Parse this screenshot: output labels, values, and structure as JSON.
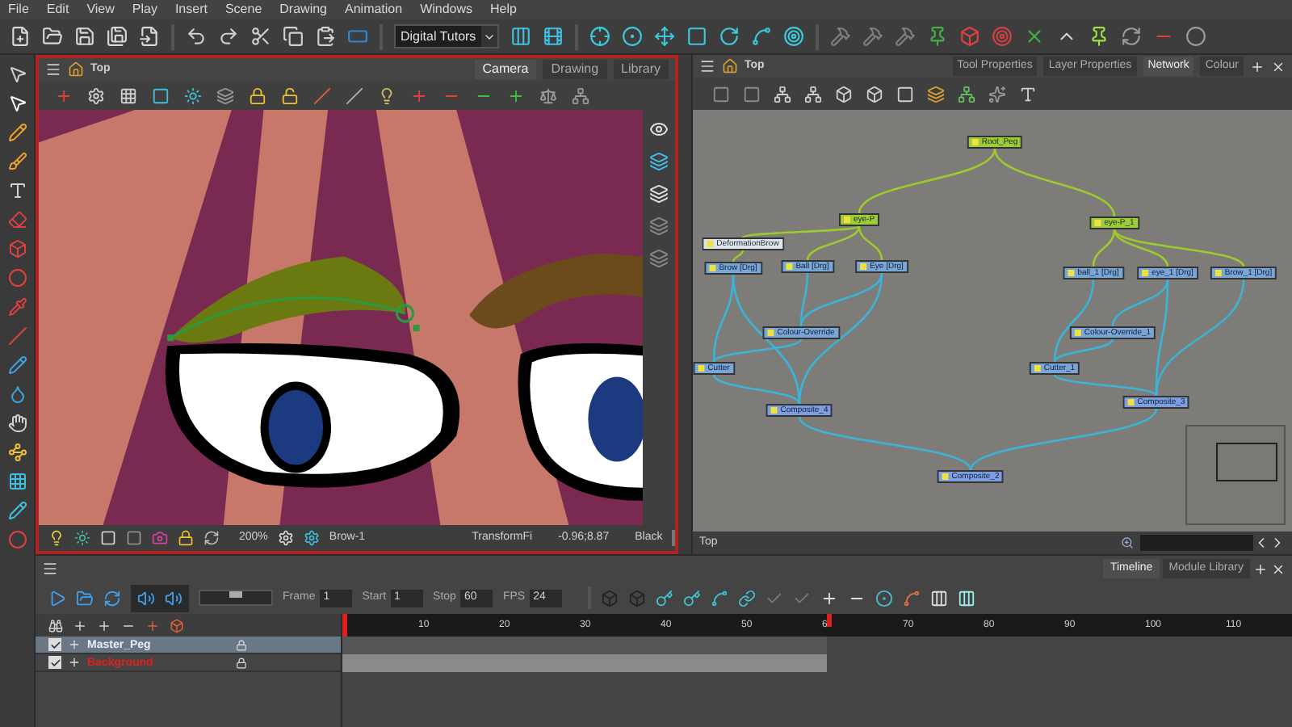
{
  "menu": [
    {
      "label": "File"
    },
    {
      "label": "Edit"
    },
    {
      "label": "View"
    },
    {
      "label": "Play"
    },
    {
      "label": "Insert"
    },
    {
      "label": "Scene"
    },
    {
      "label": "Drawing"
    },
    {
      "label": "Animation"
    },
    {
      "label": "Windows"
    },
    {
      "label": "Help"
    }
  ],
  "toolbar": {
    "workspace": "Digital Tutors"
  },
  "camera_view": {
    "breadcrumb": "Top",
    "tabs": [
      {
        "label": "Camera",
        "selected": true
      },
      {
        "label": "Drawing",
        "selected": false
      },
      {
        "label": "Library",
        "selected": false
      }
    ],
    "status": {
      "zoom": "200%",
      "drawing": "Brow-1",
      "tool": "TransformFi",
      "coords": "-0.96;8.87",
      "colour": "Black"
    }
  },
  "network_view": {
    "breadcrumb": "Top",
    "tabs": [
      {
        "label": "Tool Properties",
        "selected": false
      },
      {
        "label": "Layer Properties",
        "selected": false
      },
      {
        "label": "Network",
        "selected": true
      },
      {
        "label": "Colour",
        "selected": false
      }
    ],
    "nodes": [
      {
        "label": "Root_Peg",
        "kind": "peg"
      },
      {
        "label": "eye-P",
        "kind": "peg"
      },
      {
        "label": "eye-P_1",
        "kind": "peg"
      },
      {
        "label": "DeformationBrow",
        "kind": "deformation"
      },
      {
        "label": "Brow [Drg]",
        "kind": "drawing"
      },
      {
        "label": "Ball [Drg]",
        "kind": "drawing"
      },
      {
        "label": "Eye [Drg]",
        "kind": "drawing"
      },
      {
        "label": "ball_1 [Drg]",
        "kind": "drawing"
      },
      {
        "label": "eye_1 [Drg]",
        "kind": "drawing"
      },
      {
        "label": "Brow_1 [Drg]",
        "kind": "drawing"
      },
      {
        "label": "Colour-Override",
        "kind": "drawing"
      },
      {
        "label": "Colour-Override_1",
        "kind": "drawing"
      },
      {
        "label": "Cutter",
        "kind": "drawing"
      },
      {
        "label": "Cutter_1",
        "kind": "drawing"
      },
      {
        "label": "Composite_4",
        "kind": "composite"
      },
      {
        "label": "Composite_3",
        "kind": "composite"
      },
      {
        "label": "Composite_2",
        "kind": "composite"
      }
    ],
    "status": {
      "path": "Top"
    }
  },
  "timeline": {
    "tabs": [
      {
        "label": "Timeline",
        "selected": true
      },
      {
        "label": "Module Library",
        "selected": false
      }
    ],
    "playback_speed": {
      "level": 0.5
    },
    "fields": [
      {
        "label": "Frame",
        "value": "1"
      },
      {
        "label": "Start",
        "value": "1"
      },
      {
        "label": "Stop",
        "value": "60"
      },
      {
        "label": "FPS",
        "value": "24"
      }
    ],
    "layers": [
      {
        "name": "Master_Peg",
        "checked": true,
        "selected": true,
        "color": "#e8eef4"
      },
      {
        "name": "Background",
        "checked": true,
        "selected": false,
        "color": "#e02020"
      }
    ],
    "ruler": [
      "10",
      "20",
      "30",
      "40",
      "50",
      "6",
      "70",
      "80",
      "90",
      "100",
      "110"
    ]
  }
}
